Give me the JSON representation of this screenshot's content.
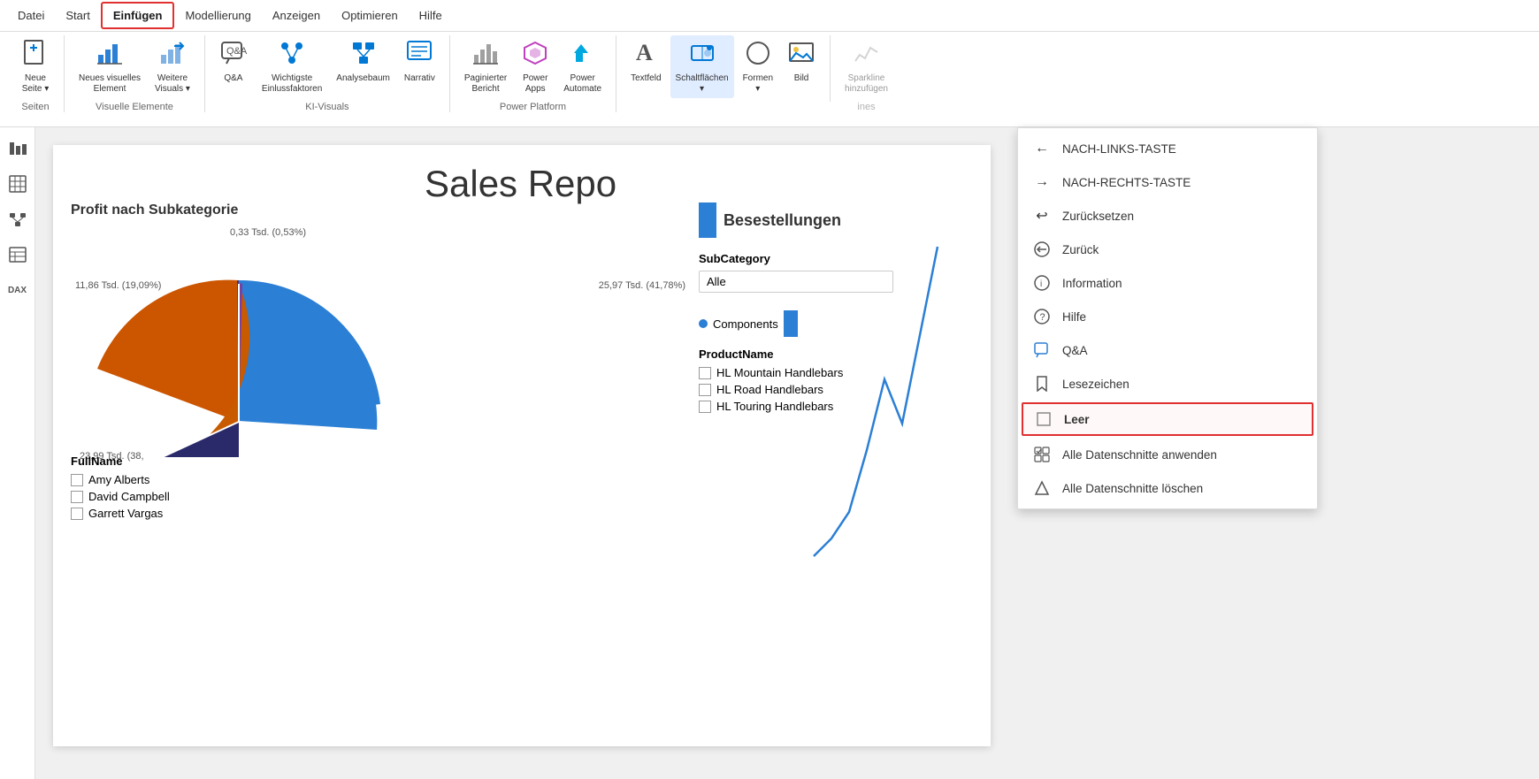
{
  "menubar": {
    "items": [
      {
        "label": "Datei",
        "active": false
      },
      {
        "label": "Start",
        "active": false
      },
      {
        "label": "Einfügen",
        "active": true
      },
      {
        "label": "Modellierung",
        "active": false
      },
      {
        "label": "Anzeigen",
        "active": false
      },
      {
        "label": "Optimieren",
        "active": false
      },
      {
        "label": "Hilfe",
        "active": false
      }
    ]
  },
  "ribbon": {
    "groups": [
      {
        "label": "Seiten",
        "items": [
          {
            "id": "neue-seite",
            "icon": "📄",
            "label": "Neue\nSeite ▾"
          }
        ]
      },
      {
        "label": "Visuelle Elemente",
        "items": [
          {
            "id": "neues-visuelles-element",
            "icon": "📊",
            "label": "Neues visuelles\nElement"
          },
          {
            "id": "weitere-visuals",
            "icon": "✏️",
            "label": "Weitere\nVisuals ▾"
          }
        ]
      },
      {
        "label": "KI-Visuals",
        "items": [
          {
            "id": "qa",
            "icon": "💬",
            "label": "Q&A"
          },
          {
            "id": "wichtigste-einfl",
            "icon": "🔀",
            "label": "Wichtigste\nEinlussfaktoren"
          },
          {
            "id": "analysebaum",
            "icon": "🌐",
            "label": "Analysebaum"
          },
          {
            "id": "narrativ",
            "icon": "📋",
            "label": "Narrativ"
          }
        ]
      },
      {
        "label": "Power Platform",
        "items": [
          {
            "id": "paginierter-bericht",
            "icon": "📈",
            "label": "Paginierter\nBericht"
          },
          {
            "id": "power-apps",
            "icon": "💎",
            "label": "Power\nApps"
          },
          {
            "id": "power-automate",
            "icon": "⚡",
            "label": "Power\nAutomate"
          }
        ]
      },
      {
        "label": "",
        "items": [
          {
            "id": "textfeld",
            "icon": "A",
            "label": "Textfeld"
          },
          {
            "id": "schaltflaechen",
            "icon": "🖱️",
            "label": "Schaltflächen\n▾",
            "active": true
          },
          {
            "id": "formen",
            "icon": "⭕",
            "label": "Formen\n▾"
          },
          {
            "id": "bild",
            "icon": "🖼️",
            "label": "Bild"
          }
        ]
      },
      {
        "label": "ines",
        "items": [
          {
            "id": "sparkline",
            "icon": "📉",
            "label": "Sparkline\nhinzufügen",
            "disabled": true
          }
        ]
      }
    ]
  },
  "sidebar": {
    "icons": [
      "📊",
      "⊞",
      "☰",
      "📋",
      "DAX"
    ]
  },
  "canvas": {
    "title": "Sales Repo",
    "profit_title": "Profit nach Subkategorie",
    "bestellungen_label": "Besestellungen",
    "pie_labels": [
      {
        "text": "0,33 Tsd. (0,53%)",
        "pos": "top"
      },
      {
        "text": "11,86 Tsd. (19,09%)",
        "pos": "left"
      },
      {
        "text": "25,97 Tsd. (41,78%)",
        "pos": "right"
      },
      {
        "text": "23,99 Tsd. (38,",
        "pos": "bottom-left"
      }
    ],
    "subcategory_label": "SubCategory",
    "filter_value": "Alle",
    "components_label": "Components",
    "fullname_label": "FullName",
    "names": [
      "Amy Alberts",
      "David Campbell",
      "Garrett Vargas"
    ],
    "productname_label": "ProductName",
    "products": [
      "HL Mountain Handlebars",
      "HL Road Handlebars",
      "HL Touring Handlebars"
    ]
  },
  "dropdown": {
    "items": [
      {
        "id": "nach-links",
        "icon": "←",
        "label": "NACH-LINKS-TASTE"
      },
      {
        "id": "nach-rechts",
        "icon": "→",
        "label": "NACH-RECHTS-TASTE"
      },
      {
        "id": "zuruecksetzen",
        "icon": "↩",
        "label": "Zurücksetzen"
      },
      {
        "id": "zurueck",
        "icon": "⊙",
        "label": "Zurück"
      },
      {
        "id": "information",
        "icon": "ℹ",
        "label": "Information"
      },
      {
        "id": "hilfe",
        "icon": "?",
        "label": "Hilfe"
      },
      {
        "id": "qa-item",
        "icon": "💬",
        "label": "Q&A"
      },
      {
        "id": "lesezeichen",
        "icon": "🔖",
        "label": "Lesezeichen"
      },
      {
        "id": "leer",
        "icon": "☐",
        "label": "Leer",
        "highlighted": true
      },
      {
        "id": "alle-datenschnitte",
        "icon": "⊞",
        "label": "Alle Datenschnitte anwenden"
      },
      {
        "id": "alle-datenschnitte-loeschen",
        "icon": "◇",
        "label": "Alle Datenschnitte löschen"
      }
    ]
  }
}
